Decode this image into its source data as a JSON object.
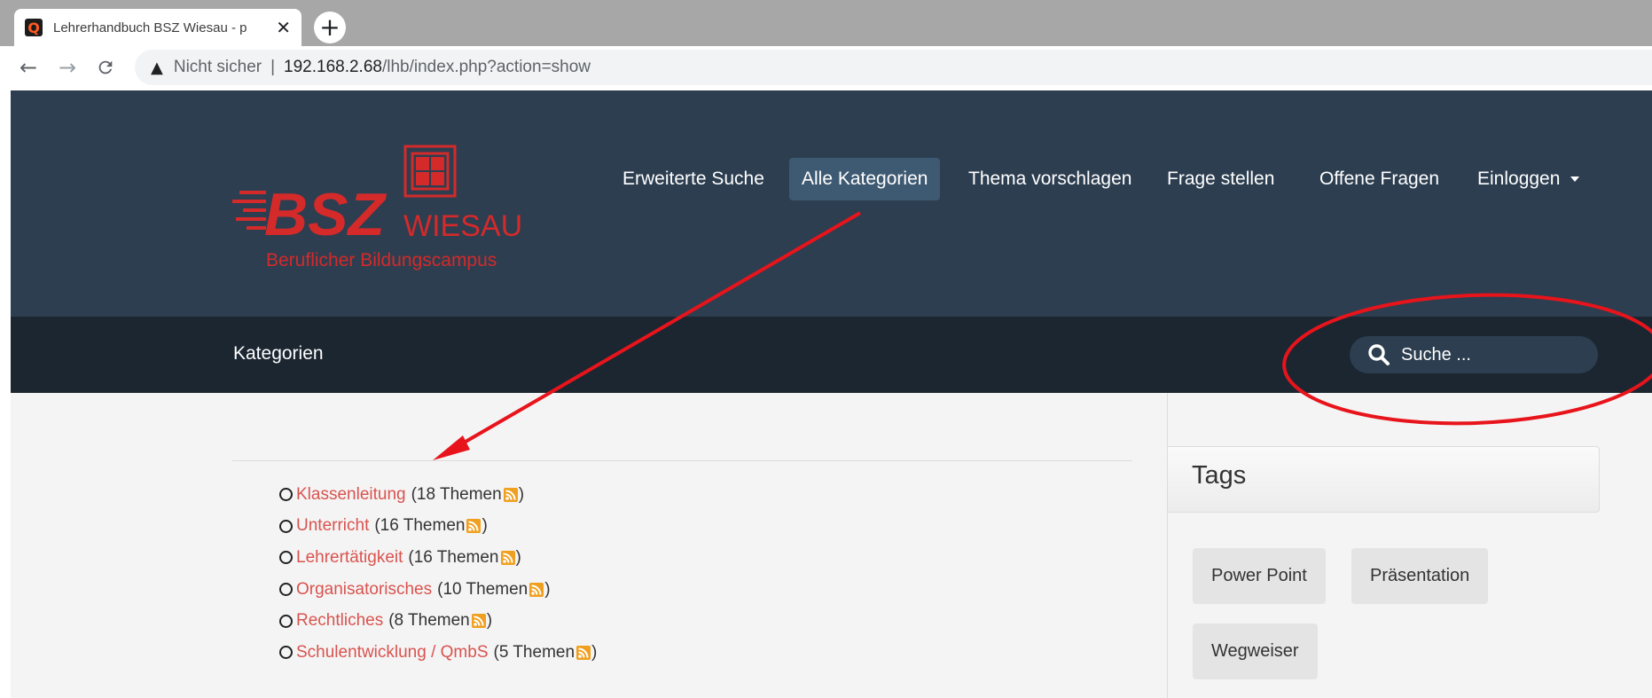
{
  "browser": {
    "tab_title": "Lehrerhandbuch BSZ Wiesau - p",
    "tab_favicon_letter": "Q",
    "new_tab": "+",
    "security_label": "Nicht sicher",
    "url_separator": "|",
    "url_host": "192.168.2.68",
    "url_path": "/lhb/index.php?action=show",
    "icons": [
      "back-arrow-icon",
      "forward-arrow-icon",
      "reload-icon",
      "warning-icon",
      "close-icon"
    ]
  },
  "logo": {
    "text_main": "BSZ",
    "text_sub": "WIESAU",
    "tagline": "Beruflicher Bildungscampus",
    "color": "#d42a2a"
  },
  "nav": {
    "items": [
      {
        "label": "Erweiterte Suche"
      },
      {
        "label": "Alle Kategorien",
        "active": true
      },
      {
        "label": "Thema vorschlagen"
      },
      {
        "label": "Frage stellen"
      },
      {
        "label": "Offene Fragen"
      },
      {
        "label": "Einloggen"
      }
    ]
  },
  "subbar": {
    "title": "Kategorien",
    "search_placeholder": "Suche ..."
  },
  "categories": [
    {
      "name": "Klassenleitung",
      "count": "(18 Themen",
      "close": ")"
    },
    {
      "name": "Unterricht",
      "count": "(16 Themen",
      "close": ")"
    },
    {
      "name": "Lehrertätigkeit",
      "count": "(16 Themen",
      "close": ")"
    },
    {
      "name": "Organisatorisches",
      "count": "(10 Themen",
      "close": ")"
    },
    {
      "name": "Rechtliches",
      "count": "(8 Themen",
      "close": ")"
    },
    {
      "name": "Schulentwicklung / QmbS",
      "count": "(5 Themen",
      "close": ")"
    }
  ],
  "sidebar": {
    "tags_title": "Tags",
    "tags": [
      {
        "label": "Power Point"
      },
      {
        "label": "Präsentation"
      },
      {
        "label": "Wegweiser"
      }
    ]
  },
  "colors": {
    "header_bg": "#2c3e50",
    "subbar_bg": "#1b2631",
    "link": "#d9534f",
    "rss": "#f0a020",
    "annotation": "#e8141b"
  }
}
